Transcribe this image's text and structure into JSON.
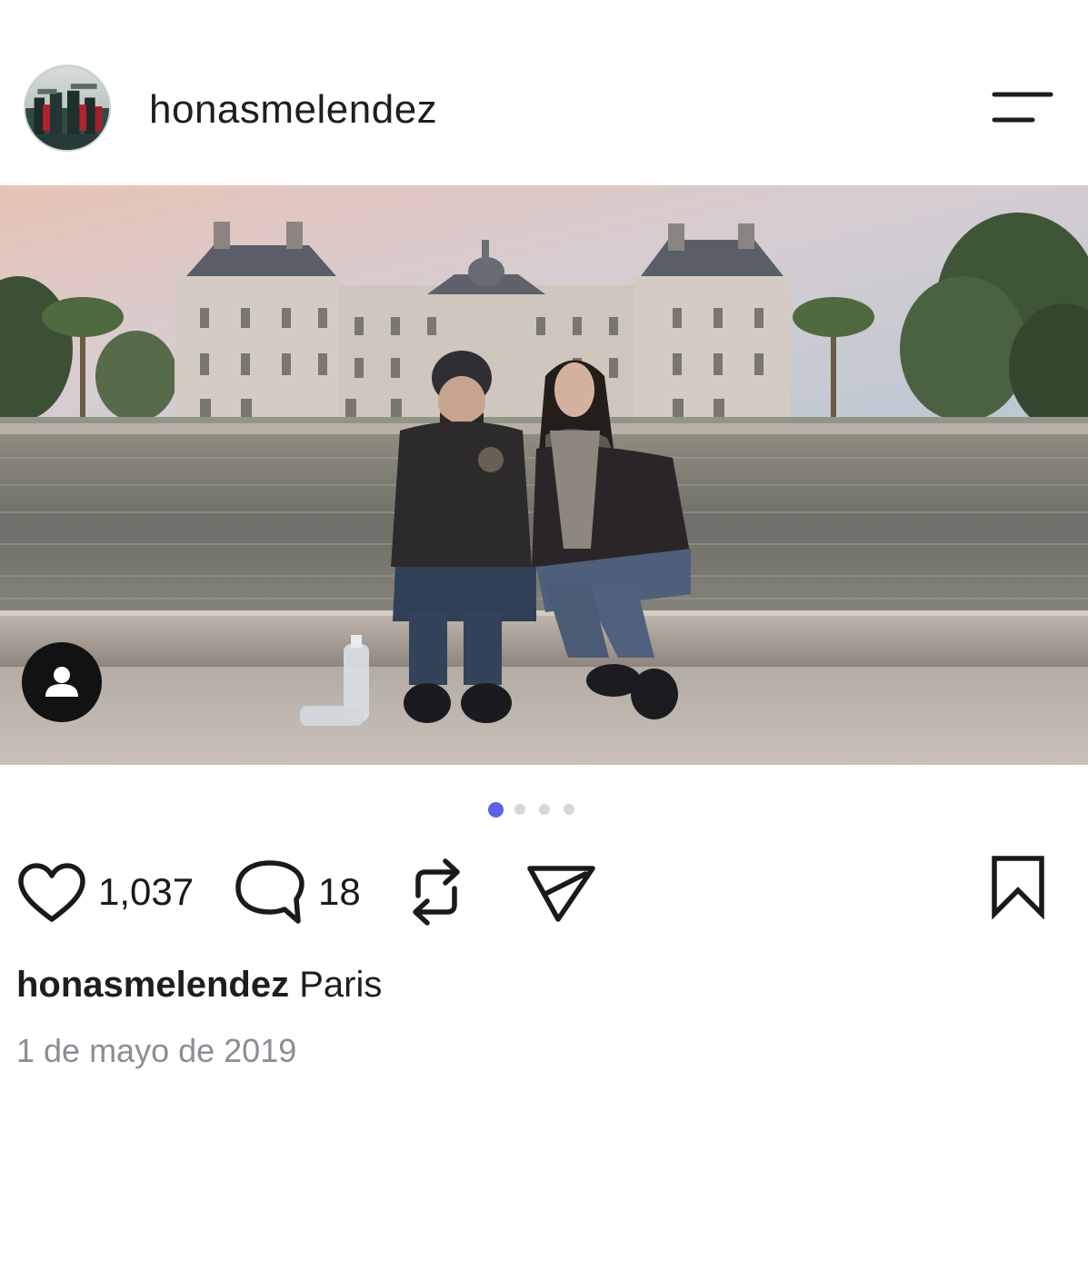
{
  "header": {
    "username": "honasmelendez",
    "avatar_icon": "profile-avatar",
    "menu_icon": "menu-lines-icon"
  },
  "post": {
    "photo_description_icon": "post-photo",
    "tag_icon": "person-tag-icon",
    "carousel": {
      "total": 4,
      "active_index": 0,
      "active_color": "#5a63e8",
      "inactive_color": "#d5d7db"
    }
  },
  "actions": {
    "likes_count": "1,037",
    "comments_count": "18",
    "like_icon": "heart-icon",
    "comment_icon": "comment-bubble-icon",
    "repost_icon": "repost-icon",
    "share_icon": "send-icon",
    "save_icon": "bookmark-icon"
  },
  "caption": {
    "username": "honasmelendez",
    "text": "Paris"
  },
  "date": "1 de mayo de 2019"
}
